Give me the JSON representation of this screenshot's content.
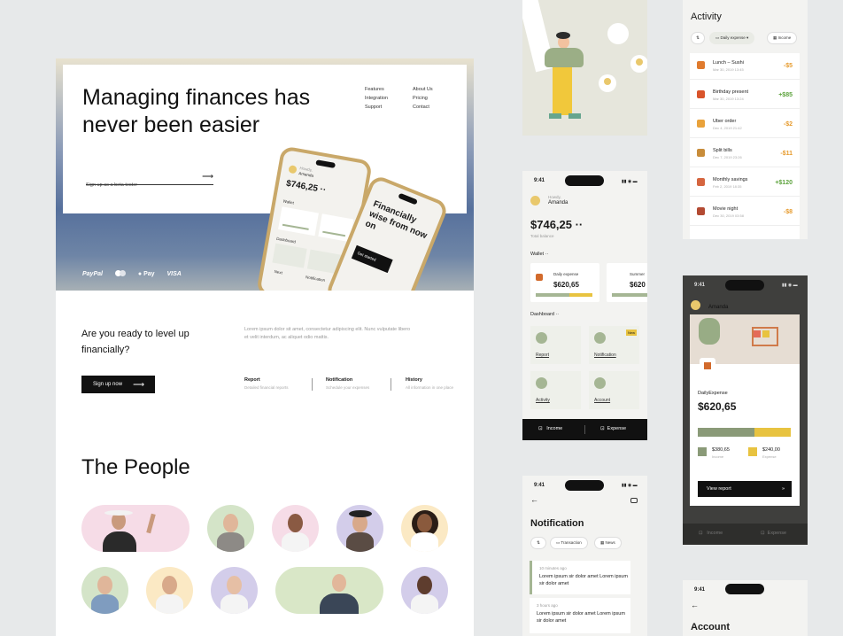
{
  "landing": {
    "headline": "Managing finances has never been easier",
    "nav": {
      "col1": [
        "Features",
        "Integration",
        "Support"
      ],
      "col2": [
        "About Us",
        "Pricing",
        "Contact"
      ]
    },
    "signup_placeholder": "Sign up as a beta tester",
    "arrow": "⟶",
    "partners": [
      "PayPal",
      "Pay",
      "VISA"
    ],
    "phone1": {
      "howdy": "Howdy,",
      "name": "Amanda",
      "balance": "$746,25 ··",
      "wallet": "Wallet",
      "dashboard": "Dashboard",
      "next": "Next",
      "label": "Notification"
    },
    "phone2": {
      "tagline": "Financially wise from now on",
      "button": "Get started"
    },
    "cta_question": "Are you ready to level up financially?",
    "cta_desc": "Lorem ipsum dolor sit amet, consectetur adipiscing elit. Nunc vulputate libero et velit interdum, ac aliquet odio mattis.",
    "cta_button": "Sign up now",
    "features": [
      {
        "title": "Report",
        "desc": "Detailed financial reports"
      },
      {
        "title": "Notification",
        "desc": "Schedule your expenses"
      },
      {
        "title": "History",
        "desc": "All information in one place"
      }
    ],
    "people_title": "The People"
  },
  "dashboard": {
    "time": "9:41",
    "howdy": "Howdy,",
    "name": "Amanda",
    "balance": "$746,25 ··",
    "balance_label": "Total balance",
    "wallet_label": "Wallet ··",
    "wallet_cards": [
      {
        "title": "Daily expense",
        "amount": "$620,65"
      },
      {
        "title": "Summer",
        "amount": "$620"
      }
    ],
    "dashboard_label": "Dashboard ··",
    "tiles": [
      "Report",
      "Notification",
      "Activity",
      "Account"
    ],
    "new_badge": "New",
    "nav": [
      "Income",
      "Expense"
    ]
  },
  "activity": {
    "title": "Activity",
    "filters": [
      "Daily expense",
      "Income"
    ],
    "rows": [
      {
        "title": "Lunch – Sushi",
        "date": "Mar 30, 2019 13:45",
        "amount": "-$5",
        "color": "#e07b2e"
      },
      {
        "title": "Birthday present",
        "date": "Mar 30, 2019 13:24",
        "amount": "+$85",
        "color": "#d9542b"
      },
      {
        "title": "Uber order",
        "date": "Dec 4, 2019 21:42",
        "amount": "-$2",
        "color": "#e9a23b"
      },
      {
        "title": "Split bills",
        "date": "Dec 7, 2019 23:26",
        "amount": "-$11",
        "color": "#c88c3a"
      },
      {
        "title": "Monthly savings",
        "date": "Feb 2, 2019 18:35",
        "amount": "+$120",
        "color": "#d5653f"
      },
      {
        "title": "Movie night",
        "date": "Dec 30, 2019 03:58",
        "amount": "-$8",
        "color": "#b34a32"
      }
    ],
    "positive_color": "#5ea33e",
    "negative_color": "#e69a2c"
  },
  "daily": {
    "time": "9:41",
    "name": "Amanda",
    "label": "DailyExpense",
    "amount": "$620,65",
    "legend": [
      {
        "amount": "$380,65",
        "label": "Income",
        "color": "#8a9a78"
      },
      {
        "amount": "$240,00",
        "label": "Expense",
        "color": "#e8c340"
      }
    ],
    "income_fraction": 0.61,
    "button": "View report",
    "nav": [
      "Income",
      "Expense"
    ]
  },
  "notification": {
    "time": "9:41",
    "title": "Notification",
    "chips": [
      "Transaction",
      "News"
    ],
    "items": [
      {
        "time": "10 minutes ago",
        "text": "Lorem ipsum sir dolor amet Lorem ipsum sir dolor amet"
      },
      {
        "time": "3 hours ago",
        "text": "Lorem ipsum sir dolor amet Lorem ipsum sir dolor amet"
      }
    ]
  },
  "account": {
    "time": "9:41",
    "title": "Account",
    "back": "←"
  },
  "colors": {
    "accent": "#a5b694",
    "yellow": "#e8c340",
    "dark": "#111111"
  }
}
